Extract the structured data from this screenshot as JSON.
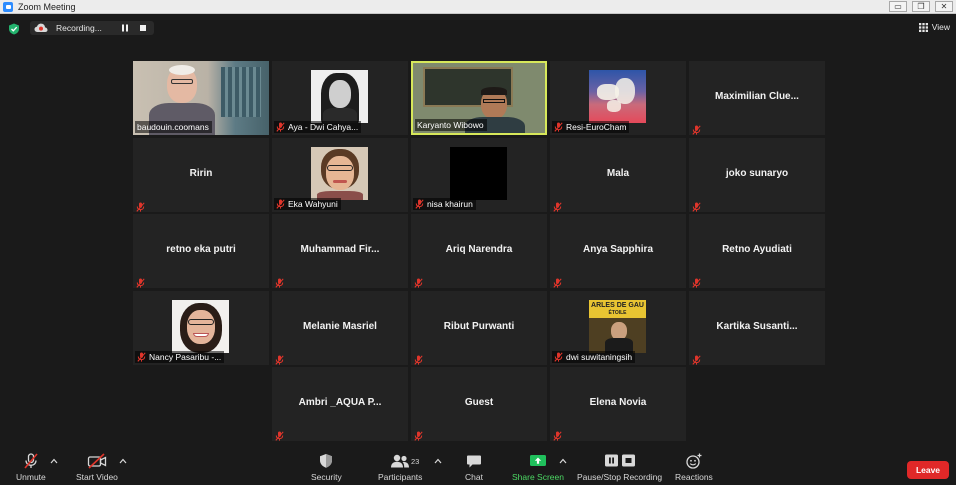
{
  "window": {
    "title": "Zoom Meeting",
    "controls": [
      "▭",
      "❐",
      "✕"
    ]
  },
  "recording": {
    "label": "Recording..."
  },
  "view_label": "View",
  "participants": [
    {
      "name": "baudouin.coomans",
      "display": "tag",
      "video": "man-glasses",
      "muted": false
    },
    {
      "name": "Aya - Dwi Cahya...",
      "display": "tag",
      "video": "woman-bw",
      "muted": true
    },
    {
      "name": "Karyanto Wibowo",
      "display": "tag",
      "video": "man-board",
      "muted": false,
      "active": true
    },
    {
      "name": "Resi-EuroCham",
      "display": "tag",
      "video": "europe-map",
      "muted": true
    },
    {
      "name": "Maximilian  Clue...",
      "display": "center",
      "muted": true
    },
    {
      "name": "Ririn",
      "display": "center",
      "muted": true
    },
    {
      "name": "Eka Wahyuni",
      "display": "tag",
      "video": "woman-glasses",
      "muted": true
    },
    {
      "name": "nisa khairun",
      "display": "tag",
      "video": "black",
      "muted": true
    },
    {
      "name": "Mala",
      "display": "center",
      "muted": true
    },
    {
      "name": "joko sunaryo",
      "display": "center",
      "muted": true
    },
    {
      "name": "retno eka putri",
      "display": "center",
      "muted": true
    },
    {
      "name": "Muhammad  Fir...",
      "display": "center",
      "muted": true
    },
    {
      "name": "Ariq Narendra",
      "display": "center",
      "muted": true
    },
    {
      "name": "Anya Sapphira",
      "display": "center",
      "muted": true
    },
    {
      "name": "Retno Ayudiati",
      "display": "center",
      "muted": true
    },
    {
      "name": "Nancy Pasaribu -...",
      "display": "tag",
      "video": "woman-smile",
      "muted": true
    },
    {
      "name": "Melanie Masriel",
      "display": "center",
      "muted": true
    },
    {
      "name": "Ribut Purwanti",
      "display": "center",
      "muted": true
    },
    {
      "name": "dwi suwitaningsih",
      "display": "tag",
      "video": "sign-photo",
      "muted": true,
      "photo_text": [
        "ARLES DE GAU",
        "ÉTOILE"
      ]
    },
    {
      "name": "Kartika  Susanti...",
      "display": "center",
      "muted": true
    },
    {
      "name": "Ambri _AQUA P...",
      "display": "center",
      "muted": true
    },
    {
      "name": "Guest",
      "display": "center",
      "muted": true
    },
    {
      "name": "Elena Novia",
      "display": "center",
      "muted": true
    }
  ],
  "toolbar": {
    "unmute": "Unmute",
    "start_video": "Start Video",
    "security": "Security",
    "participants": "Participants",
    "participant_count": "23",
    "chat": "Chat",
    "share_screen": "Share Screen",
    "pause_stop_recording": "Pause/Stop Recording",
    "reactions": "Reactions",
    "leave": "Leave"
  },
  "colors": {
    "active_speaker_border": "#d7e85a",
    "muted_icon": "#e0352b",
    "share_green": "#20c05c",
    "leave_red": "#e02828"
  }
}
